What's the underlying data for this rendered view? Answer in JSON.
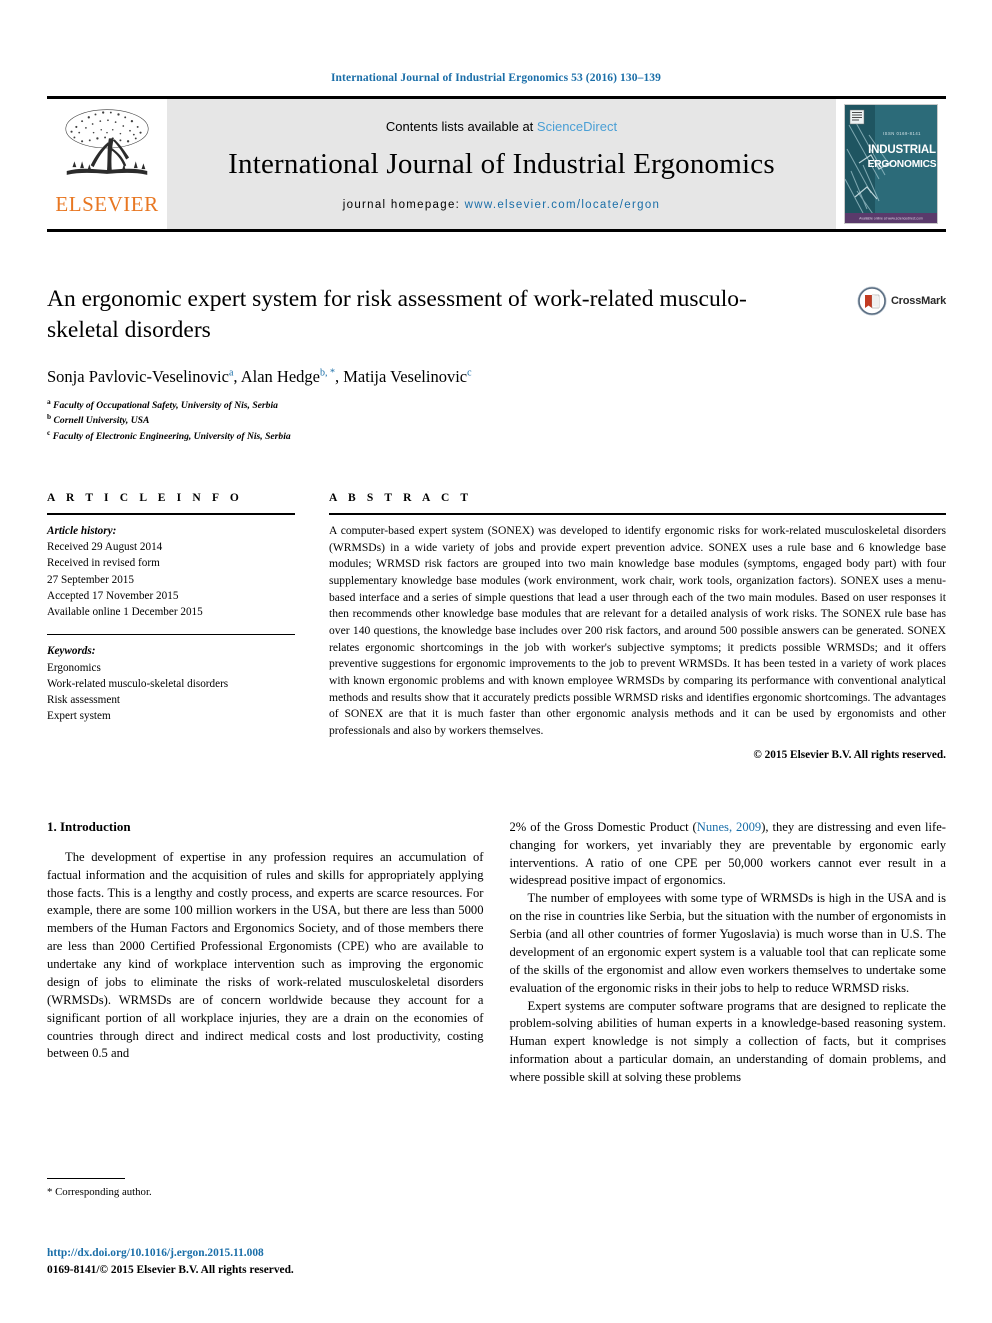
{
  "running_head": "International Journal of Industrial Ergonomics 53 (2016) 130–139",
  "masthead": {
    "publisher_name": "ELSEVIER",
    "contents_prefix": "Contents lists available at ",
    "contents_link": "ScienceDirect",
    "journal_title": "International Journal of Industrial Ergonomics",
    "homepage_prefix": "journal homepage: ",
    "homepage_url": "www.elsevier.com/locate/ergon",
    "cover": {
      "kicker": "ISSN 0169-8141",
      "line1": "INDUSTRIAL",
      "line2": "ERGONOMICS",
      "footer": "Available online at www.sciencedirect.com"
    },
    "accent_orange": "#E87722",
    "link_blue": "#1a6ea8",
    "sciencedirect_blue": "#4a9fd5",
    "panel_gray": "#e6e6e6"
  },
  "article": {
    "title": "An ergonomic expert system for risk assessment of work-related musculo-skeletal disorders",
    "authors": [
      {
        "name": "Sonja Pavlovic-Veselinovic",
        "marks": "a"
      },
      {
        "name": "Alan Hedge",
        "marks": "b, *"
      },
      {
        "name": "Matija Veselinovic",
        "marks": "c"
      }
    ],
    "affiliations": [
      {
        "mark": "a",
        "text": "Faculty of Occupational Safety, University of Nis, Serbia"
      },
      {
        "mark": "b",
        "text": "Cornell University, USA"
      },
      {
        "mark": "c",
        "text": "Faculty of Electronic Engineering, University of Nis, Serbia"
      }
    ],
    "crossmark_label": "CrossMark"
  },
  "article_info": {
    "heading": "A R T I C L E   I N F O",
    "history_label": "Article history:",
    "history": [
      "Received 29 August 2014",
      "Received in revised form",
      "27 September 2015",
      "Accepted 17 November 2015",
      "Available online 1 December 2015"
    ],
    "keywords_label": "Keywords:",
    "keywords": [
      "Ergonomics",
      "Work-related musculo-skeletal disorders",
      "Risk assessment",
      "Expert system"
    ]
  },
  "abstract": {
    "heading": "A B S T R A C T",
    "text": "A computer-based expert system (SONEX) was developed to identify ergonomic risks for work-related musculoskeletal disorders (WRMSDs) in a wide variety of jobs and provide expert prevention advice. SONEX uses a rule base and 6 knowledge base modules; WRMSD risk factors are grouped into two main knowledge base modules (symptoms, engaged body part) with four supplementary knowledge base modules (work environment, work chair, work tools, organization factors). SONEX uses a menu-based interface and a series of simple questions that lead a user through each of the two main modules. Based on user responses it then recommends other knowledge base modules that are relevant for a detailed analysis of work risks. The SONEX rule base has over 140 questions, the knowledge base includes over 200 risk factors, and around 500 possible answers can be generated. SONEX relates ergonomic shortcomings in the job with worker's subjective symptoms; it predicts possible WRMSDs; and it offers preventive suggestions for ergonomic improvements to the job to prevent WRMSDs. It has been tested in a variety of work places with known ergonomic problems and with known employee WRMSDs by comparing its performance with conventional analytical methods and results show that it accurately predicts possible WRMSD risks and identifies ergonomic shortcomings. The advantages of SONEX are that it is much faster than other ergonomic analysis methods and it can be used by ergonomists and other professionals and also by workers themselves.",
    "copyright": "© 2015 Elsevier B.V. All rights reserved."
  },
  "body": {
    "section_heading": "1. Introduction",
    "left_paragraphs": [
      "The development of expertise in any profession requires an accumulation of factual information and the acquisition of rules and skills for appropriately applying those facts. This is a lengthy and costly process, and experts are scarce resources. For example, there are some 100 million workers in the USA, but there are less than 5000 members of the Human Factors and Ergonomics Society, and of those members there are less than 2000 Certified Professional Ergonomists (CPE) who are available to undertake any kind of workplace intervention such as improving the ergonomic design of jobs to eliminate the risks of work-related musculoskeletal disorders (WRMSDs). WRMSDs are of concern worldwide because they account for a significant portion of all workplace injuries, they are a drain on the economies of countries through direct and indirect medical costs and lost productivity, costing between 0.5 and"
    ],
    "right_paragraphs": [
      {
        "pre": "2% of the Gross Domestic Product (",
        "cite": "Nunes, 2009",
        "post": "), they are distressing and even life-changing for workers, yet invariably they are preventable by ergonomic early interventions. A ratio of one CPE per 50,000 workers cannot ever result in a widespread positive impact of ergonomics.",
        "indent": false
      },
      {
        "pre": "",
        "cite": "",
        "post": "The number of employees with some type of WRMSDs is high in the USA and is on the rise in countries like Serbia, but the situation with the number of ergonomists in Serbia (and all other countries of former Yugoslavia) is much worse than in U.S. The development of an ergonomic expert system is a valuable tool that can replicate some of the skills of the ergonomist and allow even workers themselves to undertake some evaluation of the ergonomic risks in their jobs to help to reduce WRMSD risks.",
        "indent": true
      },
      {
        "pre": "",
        "cite": "",
        "post": "Expert systems are computer software programs that are designed to replicate the problem-solving abilities of human experts in a knowledge-based reasoning system. Human expert knowledge is not simply a collection of facts, but it comprises information about a particular domain, an understanding of domain problems, and where possible skill at solving these problems",
        "indent": true
      }
    ]
  },
  "footnote": {
    "corresponding": "* Corresponding author."
  },
  "footer": {
    "doi": "http://dx.doi.org/10.1016/j.ergon.2015.11.008",
    "issn_line": "0169-8141/© 2015 Elsevier B.V. All rights reserved."
  }
}
